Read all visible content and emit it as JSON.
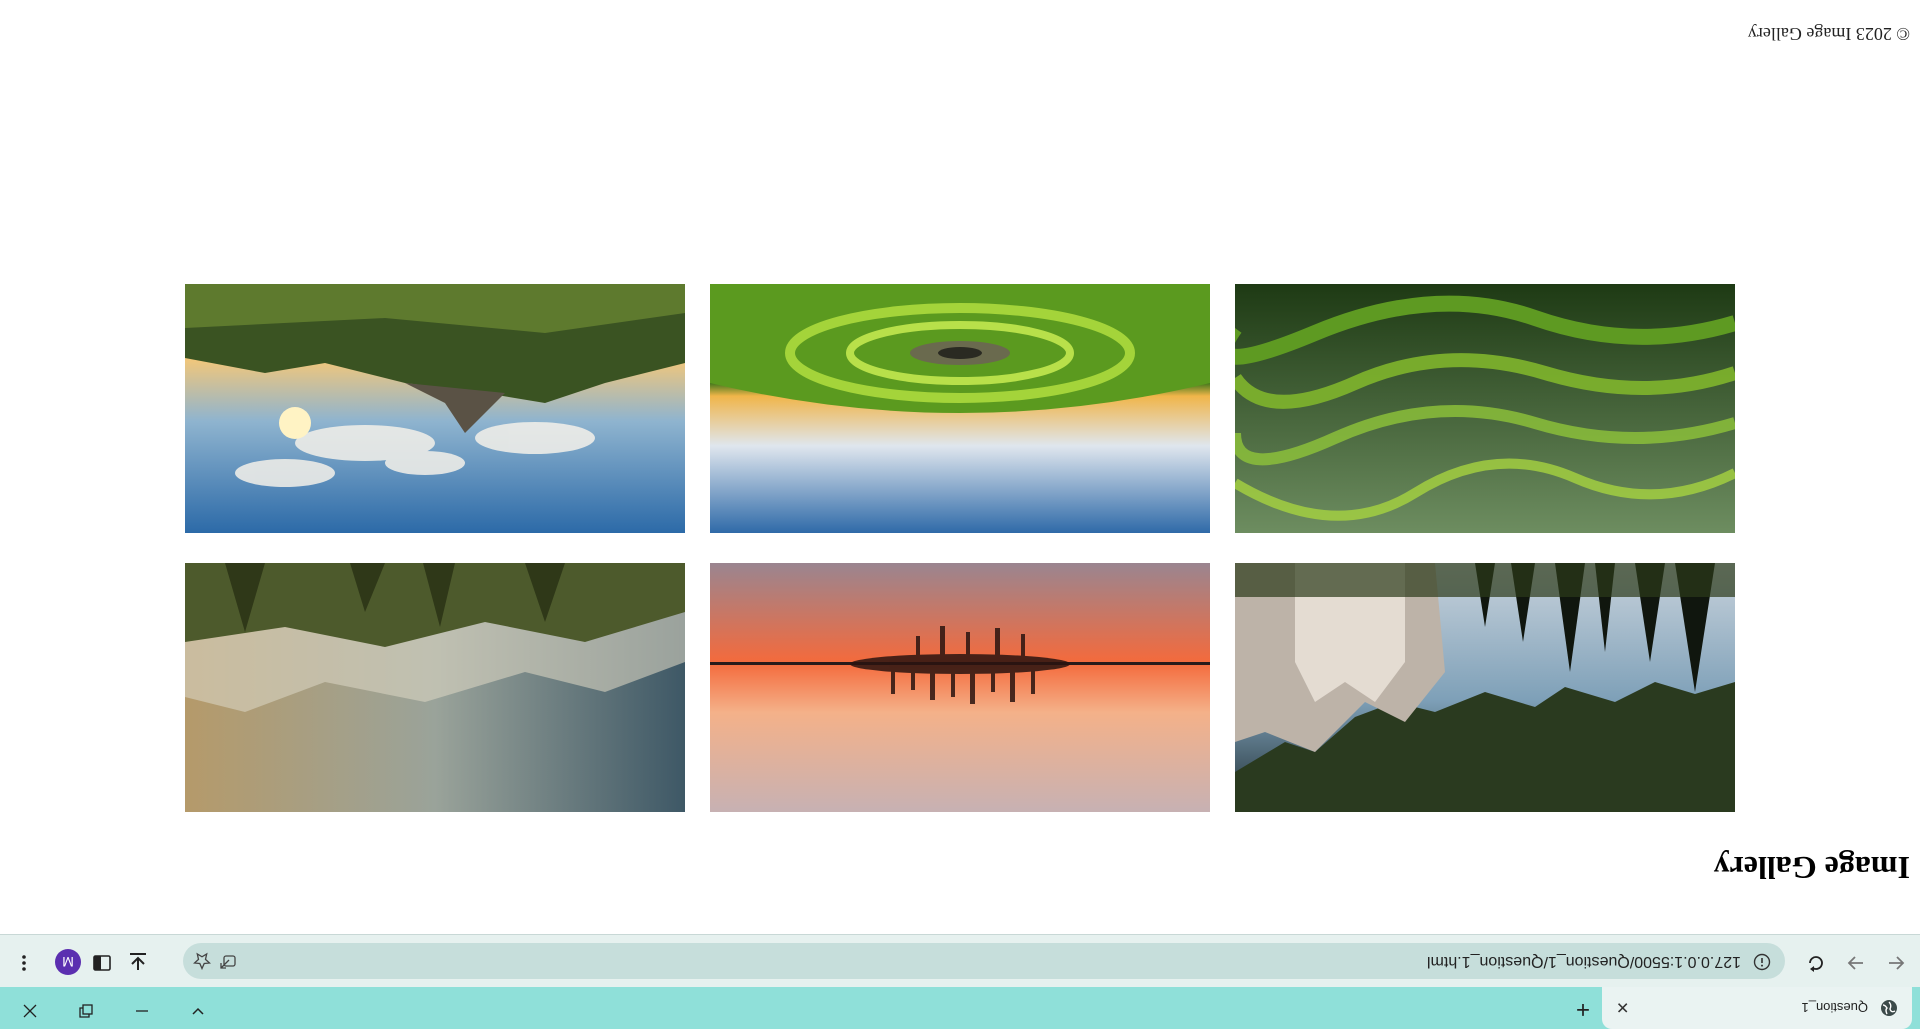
{
  "browser": {
    "tab_title": "Question_1",
    "tab_close": "✕",
    "new_tab": "+",
    "url": "127.0.0.1:5500/Question_1/Question_1.html",
    "avatar_letter": "M",
    "window_controls": {
      "minimize": "—",
      "restore": "❐",
      "close": "✕",
      "chevron": "⌄"
    }
  },
  "page": {
    "title": "Image Gallery",
    "footer": "© 2023 Image Gallery"
  },
  "gallery": {
    "images": [
      {
        "name": "mountain-valley",
        "alt": "Mountain valley with pine trees"
      },
      {
        "name": "sunset-lake-trees",
        "alt": "Sunset over lake with trees"
      },
      {
        "name": "misty-mountains",
        "alt": "Misty mountains at dawn"
      },
      {
        "name": "green-hills",
        "alt": "Green rolling hills"
      },
      {
        "name": "grass-circle-sky",
        "alt": "Grass crater under blue sky"
      },
      {
        "name": "cliffs-clouds",
        "alt": "Cliffs with sunlit clouds"
      }
    ]
  }
}
